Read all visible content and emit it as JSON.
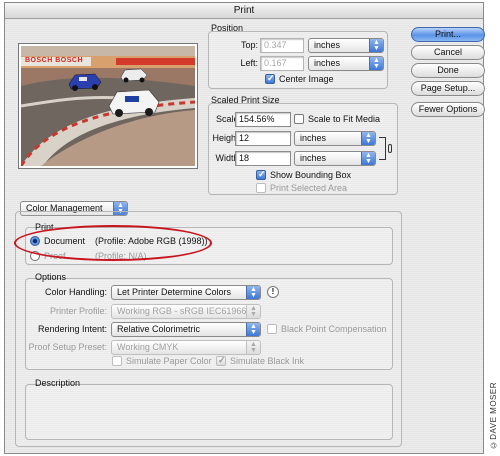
{
  "window": {
    "title": "Print"
  },
  "position": {
    "group_title": "Position",
    "top_label": "Top:",
    "top_value": "0.347",
    "top_units": "inches",
    "left_label": "Left:",
    "left_value": "0.167",
    "left_units": "inches",
    "center_image_label": "Center Image",
    "center_image_checked": true
  },
  "scaled_print_size": {
    "group_title": "Scaled Print Size",
    "scale_label": "Scale:",
    "scale_value": "154.56%",
    "scale_to_fit_label": "Scale to Fit Media",
    "scale_to_fit_checked": false,
    "height_label": "Height:",
    "height_value": "12",
    "height_units": "inches",
    "width_label": "Width:",
    "width_value": "18",
    "width_units": "inches",
    "show_bounding_box_label": "Show Bounding Box",
    "show_bounding_box_checked": true,
    "print_selected_area_label": "Print Selected Area",
    "print_selected_area_checked": false
  },
  "buttons": {
    "print": "Print...",
    "cancel": "Cancel",
    "done": "Done",
    "page_setup": "Page Setup...",
    "fewer_options": "Fewer Options"
  },
  "color_management": {
    "mode_popup": "Color Management",
    "print_group_title": "Print",
    "document_label": "Document",
    "document_profile": "(Profile: Adobe RGB (1998))",
    "proof_label": "Proof",
    "proof_profile": "(Profile: N/A)",
    "selected": "document",
    "highlight_color": "#c8141e"
  },
  "options": {
    "group_title": "Options",
    "color_handling_label": "Color Handling:",
    "color_handling_value": "Let Printer Determine Colors",
    "info_icon_text": "!",
    "printer_profile_label": "Printer Profile:",
    "printer_profile_value": "Working RGB - sRGB IEC61966...",
    "rendering_intent_label": "Rendering Intent:",
    "rendering_intent_value": "Relative Colorimetric",
    "black_point_label": "Black Point Compensation",
    "black_point_checked": false,
    "proof_setup_label": "Proof Setup Preset:",
    "proof_setup_value": "Working CMYK",
    "simulate_paper_label": "Simulate Paper Color",
    "simulate_paper_checked": false,
    "simulate_ink_label": "Simulate Black Ink",
    "simulate_ink_checked": true
  },
  "description": {
    "group_title": "Description"
  },
  "preview": {
    "banner_text": "BOSCH  BOSCH"
  },
  "credit": "©DAVE MOSER"
}
